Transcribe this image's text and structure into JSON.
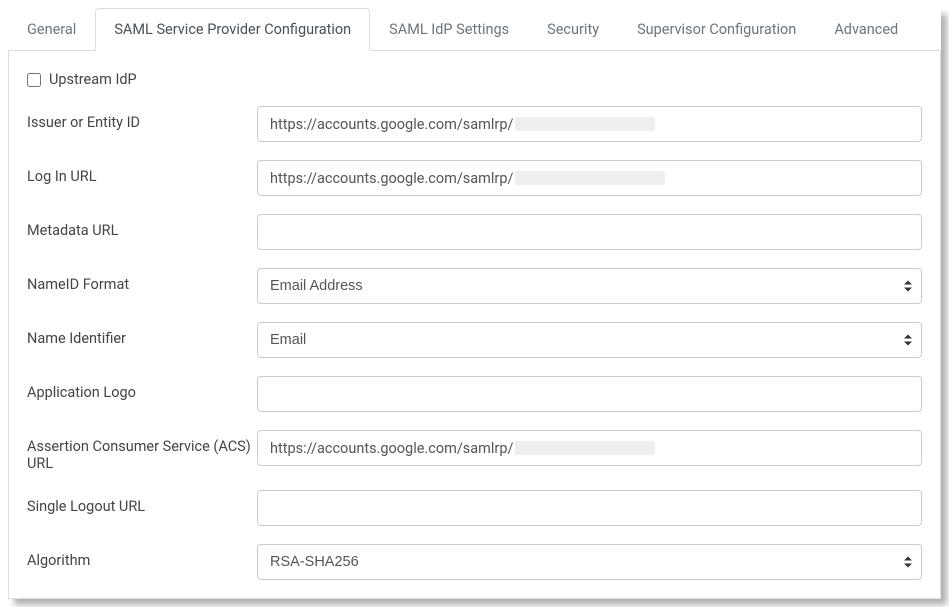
{
  "tabs": {
    "general": "General",
    "saml_sp": "SAML Service Provider Configuration",
    "saml_idp": "SAML IdP Settings",
    "security": "Security",
    "supervisor": "Supervisor Configuration",
    "advanced": "Advanced"
  },
  "form": {
    "upstream_idp": {
      "label": "Upstream IdP",
      "checked": false
    },
    "issuer": {
      "label": "Issuer or Entity ID",
      "value_prefix": "https://accounts.google.com/samlrp/",
      "value_redacted": true
    },
    "login_url": {
      "label": "Log In URL",
      "value_prefix": "https://accounts.google.com/samlrp/",
      "value_redacted": true
    },
    "metadata_url": {
      "label": "Metadata URL",
      "value": ""
    },
    "nameid_format": {
      "label": "NameID Format",
      "value": "Email Address"
    },
    "name_identifier": {
      "label": "Name Identifier",
      "value": "Email"
    },
    "app_logo": {
      "label": "Application Logo",
      "value": ""
    },
    "acs_url": {
      "label": "Assertion Consumer Service (ACS) URL",
      "value_prefix": "https://accounts.google.com/samlrp/",
      "value_redacted": true
    },
    "slo_url": {
      "label": "Single Logout URL",
      "value": ""
    },
    "algorithm": {
      "label": "Algorithm",
      "value": "RSA-SHA256"
    }
  }
}
